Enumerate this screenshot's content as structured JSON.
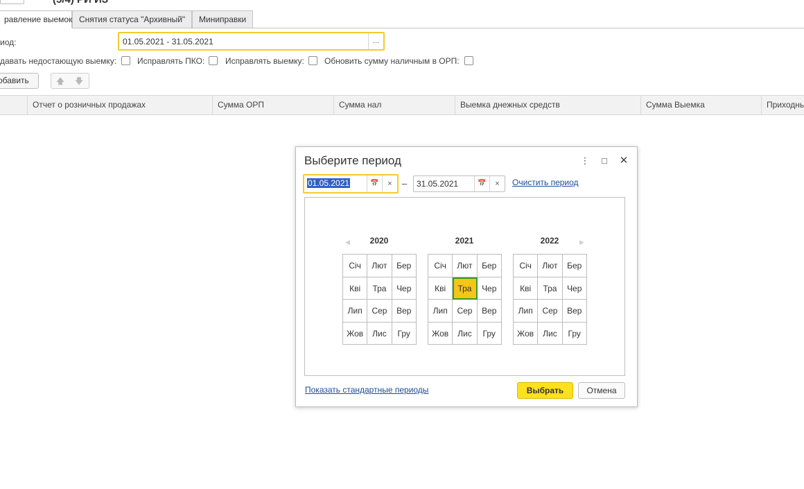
{
  "header": {
    "title": "(5/4) РИ ИЗ"
  },
  "tabs": [
    {
      "label": "равление выемок",
      "active": true
    },
    {
      "label": "Снятия статуса \"Архивный\"",
      "active": false
    },
    {
      "label": "Миниправки",
      "active": false
    }
  ],
  "period": {
    "label": "иод:",
    "value": "01.05.2021 - 31.05.2021",
    "select_button": "..."
  },
  "checkboxes": [
    {
      "label": "давать недостающую выемку:",
      "checked": false
    },
    {
      "label": "Исправлять ПКО:",
      "checked": false
    },
    {
      "label": "Исправлять выемку:",
      "checked": false
    },
    {
      "label": "Обновить сумму наличным в ОРП:",
      "checked": false
    }
  ],
  "toolbar": {
    "add_label": "обавить",
    "up_icon": "arrow-up-icon",
    "down_icon": "arrow-down-icon"
  },
  "table": {
    "columns": [
      "Отчет о розничных продажах",
      "Сумма ОРП",
      "Сумма нал",
      "Выемка днежных средств",
      "Сумма Выемка",
      "Приходны"
    ]
  },
  "dialog": {
    "title": "Выберите период",
    "from_date": "01.05.2021",
    "to_date": "31.05.2021",
    "dash": "–",
    "clear_link": "Очистить период",
    "clear_glyph": "×",
    "years": [
      {
        "year": "2020",
        "months": [
          "Січ",
          "Лют",
          "Бер",
          "Кві",
          "Тра",
          "Чер",
          "Лип",
          "Сер",
          "Вер",
          "Жов",
          "Лис",
          "Гру"
        ]
      },
      {
        "year": "2021",
        "months": [
          "Січ",
          "Лют",
          "Бер",
          "Кві",
          "Тра",
          "Чер",
          "Лип",
          "Сер",
          "Вер",
          "Жов",
          "Лис",
          "Гру"
        ],
        "selected_month": "Тра"
      },
      {
        "year": "2022",
        "months": [
          "Січ",
          "Лют",
          "Бер",
          "Кві",
          "Тра",
          "Чер",
          "Лип",
          "Сер",
          "Вер",
          "Жов",
          "Лис",
          "Гру"
        ]
      }
    ],
    "std_periods_link": "Показать стандартные периоды",
    "ok_label": "Выбрать",
    "cancel_label": "Отмена",
    "colors": {
      "accent": "#f3cb2d",
      "ok_bg": "#ffe01c",
      "selected_cell": "#f5c518",
      "selected_border": "#2f9c2f",
      "link": "#1c4b96"
    }
  }
}
